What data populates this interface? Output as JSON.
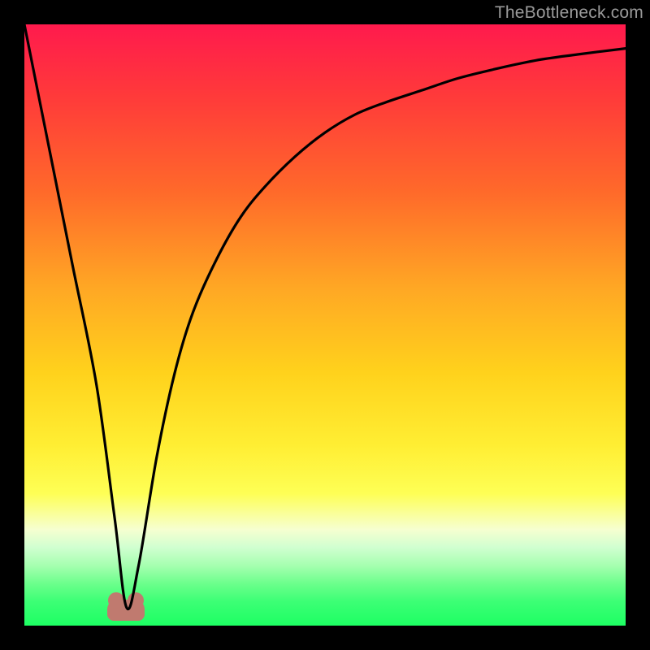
{
  "watermark": "TheBottleneck.com",
  "colors": {
    "frame": "#000000",
    "curve": "#000000",
    "bump": "#c07a6f",
    "gradient_top": "#ff1a4d",
    "gradient_bottom": "#1dff63"
  },
  "chart_data": {
    "type": "line",
    "title": "",
    "xlabel": "",
    "ylabel": "",
    "xlim": [
      0,
      100
    ],
    "ylim": [
      0,
      100
    ],
    "annotations": [
      {
        "name": "optimal-marker",
        "x": 17,
        "y": 3
      }
    ],
    "series": [
      {
        "name": "bottleneck-curve",
        "x": [
          0,
          4,
          8,
          12,
          15,
          17,
          19,
          22,
          25,
          28,
          32,
          36,
          40,
          45,
          50,
          55,
          60,
          66,
          72,
          78,
          85,
          92,
          100
        ],
        "values": [
          100,
          80,
          60,
          40,
          18,
          3,
          10,
          28,
          42,
          52,
          61,
          68,
          73,
          78,
          82,
          85,
          87,
          89,
          91,
          92.5,
          94,
          95,
          96
        ]
      }
    ]
  }
}
